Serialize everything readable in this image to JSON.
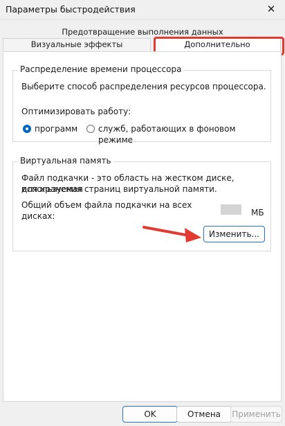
{
  "window": {
    "title": "Параметры быстродействия",
    "close_symbol": "✕"
  },
  "tabs": {
    "data_execution": "Предотвращение выполнения данных",
    "visual_effects": "Визуальные эффекты",
    "advanced": "Дополнительно"
  },
  "processor": {
    "title": "Распределение времени процессора",
    "description": "Выберите способ распределения ресурсов процессора.",
    "optimize_label": "Оптимизировать работу:",
    "option_programs": "программ",
    "option_services": "служб, работающих в фоновом режиме",
    "selected": "programs"
  },
  "virtual_memory": {
    "title": "Виртуальная память",
    "description_line1": "Файл подкачки - это область на жестком диске, используемая",
    "description_line2": "для хранения страниц виртуальной памяти.",
    "total_label_line1": "Общий объем файла подкачки на всех",
    "total_label_line2": "дисках:",
    "unit": "МБ",
    "change_button": "Изменить..."
  },
  "footer": {
    "ok": "OK",
    "cancel": "Отмена",
    "apply": "Применить"
  },
  "colors": {
    "accent": "#0067c0",
    "highlight": "#e23a31"
  }
}
